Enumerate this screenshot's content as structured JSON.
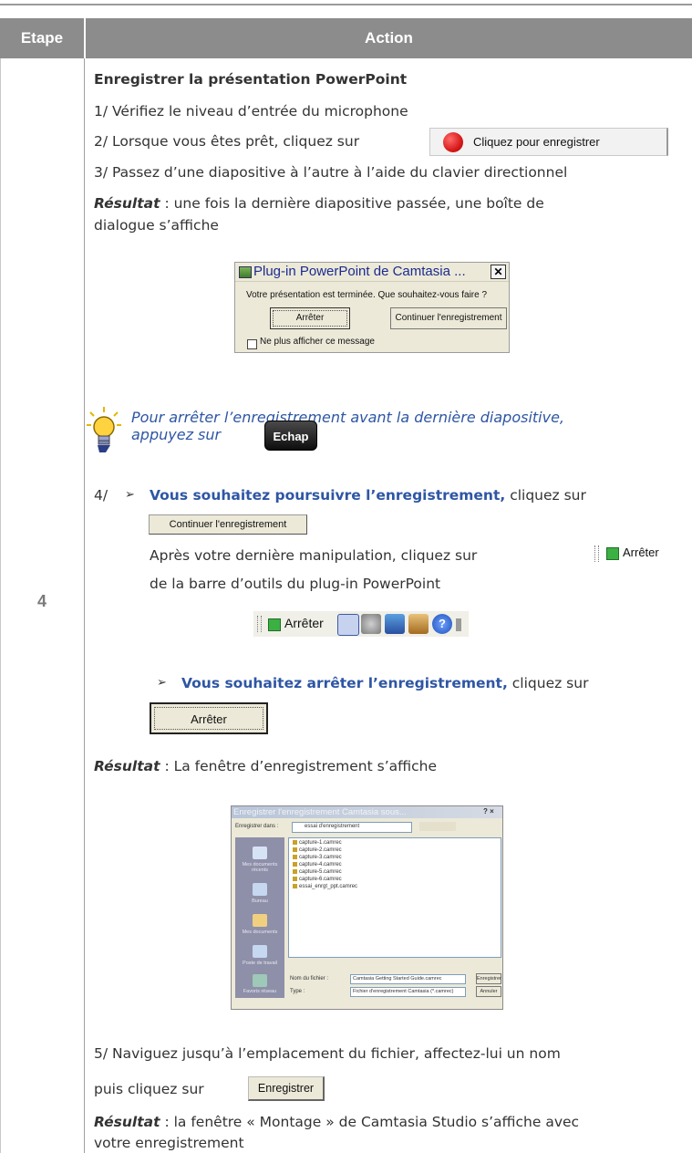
{
  "table": {
    "col_step": "Etape",
    "col_action": "Action",
    "step_number": "4"
  },
  "section_title": "Enregistrer la présentation PowerPoint",
  "steps": {
    "s1": "1/ Vérifiez le niveau d’entrée du microphone",
    "s2": "2/ Lorsque vous êtes prêt, cliquez sur",
    "s3": "3/ Passez d’une diapositive à l’autre à l’aide du clavier directionnel",
    "s4_num": "4/",
    "s4a_bullet": "➢",
    "s4a_bold": "Vous souhaitez poursuivre l’enregistrement,",
    "s4a_rest": " cliquez sur",
    "s4a_after": "Après votre dernière manipulation, cliquez sur",
    "s4a_after2": "de la barre d’outils du plug-in PowerPoint",
    "s4b_bullet": "➢",
    "s4b_bold": "Vous souhaitez arrêter l’enregistrement,",
    "s4b_rest": " cliquez sur",
    "s5_line1": "5/ Naviguez jusqu’à l’emplacement du fichier, affectez-lui un nom",
    "s5_line2": "puis cliquez sur"
  },
  "results": {
    "label": "Résultat",
    "r1_line1": " : une fois la dernière diapositive passée, une boîte de",
    "r1_line2": "dialogue s’affiche",
    "r2": " : La fenêtre d’enregistrement s’affiche",
    "r3_line1": " : la fenêtre « Montage » de Camtasia Studio s’affiche avec",
    "r3_line2": "votre enregistrement"
  },
  "tip": {
    "line1": "Pour arrêter l’enregistrement avant la dernière diapositive,",
    "line2": "appuyez sur",
    "key": "Echap"
  },
  "record_button": {
    "label": "Cliquez pour enregistrer"
  },
  "end_dialog": {
    "title": "Plug-in PowerPoint de Camtasia ...",
    "close": "✕",
    "message": "Votre présentation est terminée. Que souhaitez-vous faire ?",
    "stop_button": "Arrêter",
    "continue_button": "Continuer l'enregistrement",
    "checkbox_label": "Ne plus afficher ce message"
  },
  "continue_button": {
    "label": "Continuer l'enregistrement"
  },
  "stop_toolbar_button": {
    "label": "Arrêter"
  },
  "plugin_toolbar": {
    "stop_label": "Arrêter"
  },
  "stop_button": {
    "label": "Arrêter"
  },
  "save_dialog": {
    "title": "Enregistrer l'enregistrement Camtasia sous...",
    "title_buttons": "? ×",
    "save_in_label": "Enregistrer dans :",
    "save_in_value": "essai d'enregistrement",
    "sidebar": [
      "Mes documents récents",
      "Bureau",
      "Mes documents",
      "Poste de travail",
      "Favoris réseau"
    ],
    "files": [
      "capture-1.camrec",
      "capture-2.camrec",
      "capture-3.camrec",
      "capture-4.camrec",
      "capture-5.camrec",
      "capture-6.camrec",
      "essai_enrgt_ppt.camrec"
    ],
    "filename_label": "Nom du fichier :",
    "filename_value": "Camtasia Getting Started Guide.camrec",
    "type_label": "Type :",
    "type_value": "Fichier d'enregistrement Camtasia (*.camrec)",
    "save_button": "Enregistrer",
    "cancel_button": "Annuler"
  },
  "save_button": {
    "label": "Enregistrer"
  },
  "colors": {
    "header_bg": "#8c8c8c",
    "blue_text": "#2e56a4",
    "record_dot": "#d81a1a",
    "key_bg": "#111111"
  }
}
